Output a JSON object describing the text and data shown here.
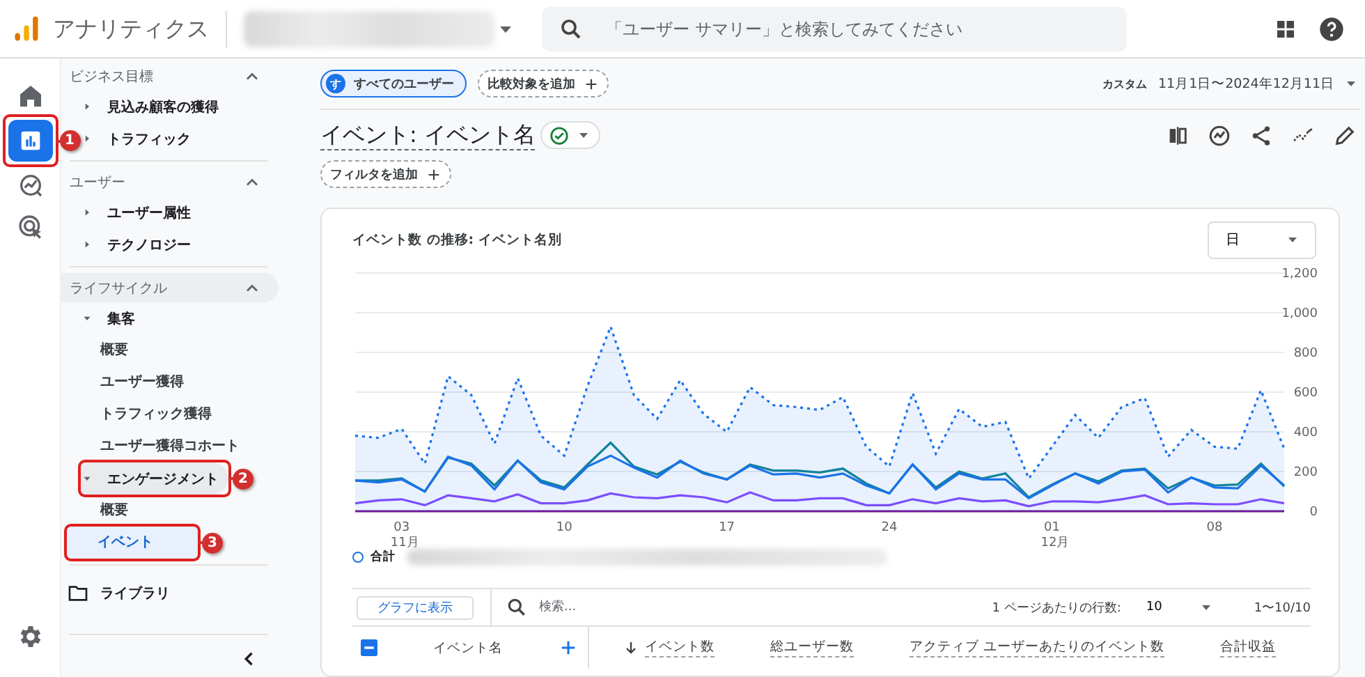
{
  "header": {
    "product": "アナリティクス",
    "property": {
      "redacted": true
    },
    "search_placeholder": "「ユーザー サマリー」と検索してみてください"
  },
  "rail": [
    {
      "kind": "home",
      "selected": false
    },
    {
      "kind": "reports",
      "selected": true,
      "callout": "1"
    },
    {
      "kind": "explore",
      "selected": false
    },
    {
      "kind": "advertising",
      "selected": false
    }
  ],
  "rail_footer": {
    "kind": "settings"
  },
  "sidebar": {
    "sections": [
      {
        "title": "ビジネス目標",
        "expanded": true,
        "highlighted": false,
        "children": [
          {
            "label": "見込み顧客の獲得",
            "expanded": false
          },
          {
            "label": "トラフィック",
            "expanded": false
          }
        ]
      },
      {
        "title": "ユーザー",
        "expanded": true,
        "highlighted": false,
        "children": [
          {
            "label": "ユーザー属性",
            "expanded": false
          },
          {
            "label": "テクノロジー",
            "expanded": false
          }
        ]
      },
      {
        "title": "ライフサイクル",
        "expanded": true,
        "highlighted": true,
        "children": [
          {
            "label": "集客",
            "expanded": true,
            "highlighted": false,
            "children": [
              {
                "label": "概要",
                "selected": false
              },
              {
                "label": "ユーザー獲得",
                "selected": false
              },
              {
                "label": "トラフィック獲得",
                "selected": false
              },
              {
                "label": "ユーザー獲得コホート",
                "selected": false
              }
            ]
          },
          {
            "label": "エンゲージメント",
            "expanded": true,
            "highlighted": true,
            "callout": "2",
            "children": [
              {
                "label": "概要",
                "selected": false
              },
              {
                "label": "イベント",
                "selected": true,
                "callout": "3"
              }
            ]
          }
        ]
      }
    ],
    "library": "ライブラリ"
  },
  "segments": [
    {
      "kind": "segment",
      "avatar": "す",
      "label": "すべてのユーザー"
    },
    {
      "kind": "add",
      "label": "比較対象を追加"
    }
  ],
  "date_range": {
    "prefix": "カスタム",
    "value": "11月1日〜2024年12月11日"
  },
  "report": {
    "title": "イベント: イベント名",
    "verified": true,
    "filter_button": "フィルタを追加"
  },
  "card": {
    "title": "イベント数 の推移: イベント名別",
    "granularity": "日",
    "chart_data": {
      "type": "line",
      "categories": [
        null,
        null,
        "03",
        null,
        null,
        null,
        null,
        null,
        null,
        "10",
        null,
        null,
        null,
        null,
        null,
        null,
        "17",
        null,
        null,
        null,
        null,
        null,
        null,
        "24",
        null,
        null,
        null,
        null,
        null,
        null,
        "01",
        null,
        null,
        null,
        null,
        null,
        null,
        "08",
        null,
        null,
        null
      ],
      "ylim": [
        0,
        1200
      ],
      "grid": true,
      "yticks": [
        {
          "value": 0,
          "label": "0"
        },
        {
          "value": 200,
          "label": "200"
        },
        {
          "value": 400,
          "label": "400"
        },
        {
          "value": 600,
          "label": "600"
        },
        {
          "value": 800,
          "label": "800"
        },
        {
          "value": 1000,
          "label": "1,000"
        },
        {
          "value": 1200,
          "label": "1,200"
        }
      ],
      "series": [
        {
          "name": "合計",
          "type": "area",
          "color": "#1a73e8",
          "line_style": "dotted",
          "values": [
            380,
            370,
            415,
            240,
            680,
            585,
            340,
            670,
            380,
            280,
            630,
            930,
            585,
            465,
            660,
            490,
            400,
            625,
            535,
            525,
            510,
            575,
            325,
            225,
            595,
            290,
            515,
            425,
            450,
            165,
            325,
            485,
            370,
            525,
            570,
            275,
            410,
            325,
            315,
            610,
            315
          ]
        },
        {
          "color": "#12829a",
          "values": [
            155,
            155,
            165,
            100,
            270,
            240,
            130,
            255,
            155,
            120,
            235,
            345,
            225,
            185,
            250,
            195,
            160,
            235,
            205,
            205,
            195,
            215,
            140,
            90,
            235,
            120,
            200,
            165,
            190,
            70,
            135,
            190,
            150,
            205,
            215,
            115,
            170,
            130,
            135,
            240,
            125
          ]
        },
        {
          "color": "#1a73e8",
          "values": [
            155,
            145,
            160,
            100,
            275,
            230,
            110,
            255,
            145,
            110,
            225,
            280,
            220,
            170,
            255,
            190,
            160,
            230,
            185,
            190,
            170,
            190,
            130,
            90,
            235,
            110,
            190,
            160,
            160,
            65,
            130,
            190,
            140,
            200,
            210,
            95,
            170,
            120,
            115,
            230,
            130
          ]
        },
        {
          "color": "#7c4dff",
          "values": [
            40,
            55,
            60,
            30,
            80,
            65,
            50,
            85,
            40,
            40,
            55,
            90,
            70,
            65,
            80,
            70,
            45,
            95,
            55,
            55,
            65,
            65,
            30,
            30,
            60,
            40,
            65,
            50,
            55,
            25,
            50,
            50,
            45,
            60,
            80,
            35,
            40,
            35,
            35,
            60,
            40
          ]
        },
        {
          "color": "#6a1b9a",
          "values": [
            0,
            0,
            0,
            0,
            0,
            0,
            0,
            0,
            0,
            0,
            0,
            0,
            0,
            0,
            0,
            0,
            0,
            0,
            0,
            0,
            0,
            0,
            0,
            0,
            0,
            0,
            0,
            0,
            0,
            0,
            0,
            0,
            0,
            0,
            0,
            0,
            0,
            0,
            0,
            0,
            0
          ]
        }
      ]
    },
    "month_labels": [
      "11月",
      "12月"
    ],
    "legend_redacted": true
  },
  "table": {
    "chart_button": "グラフに表示",
    "search_placeholder": "検索...",
    "rows_per_page_label": "1 ページあたりの行数:",
    "rows_per_page": "10",
    "range": "1〜10/10",
    "select_all": {
      "indeterminate": true
    },
    "columns": [
      {
        "kind": "dimension",
        "label": "イベント名",
        "sorted": false
      },
      {
        "kind": "metric",
        "label": "イベント数",
        "sorted": true
      },
      {
        "kind": "metric",
        "label": "総ユーザー数",
        "sorted": false
      },
      {
        "kind": "metric",
        "label": "アクティブ ユーザーあたりのイベント数",
        "sorted": false
      },
      {
        "kind": "metric",
        "label": "合計収益",
        "sorted": false
      }
    ]
  }
}
